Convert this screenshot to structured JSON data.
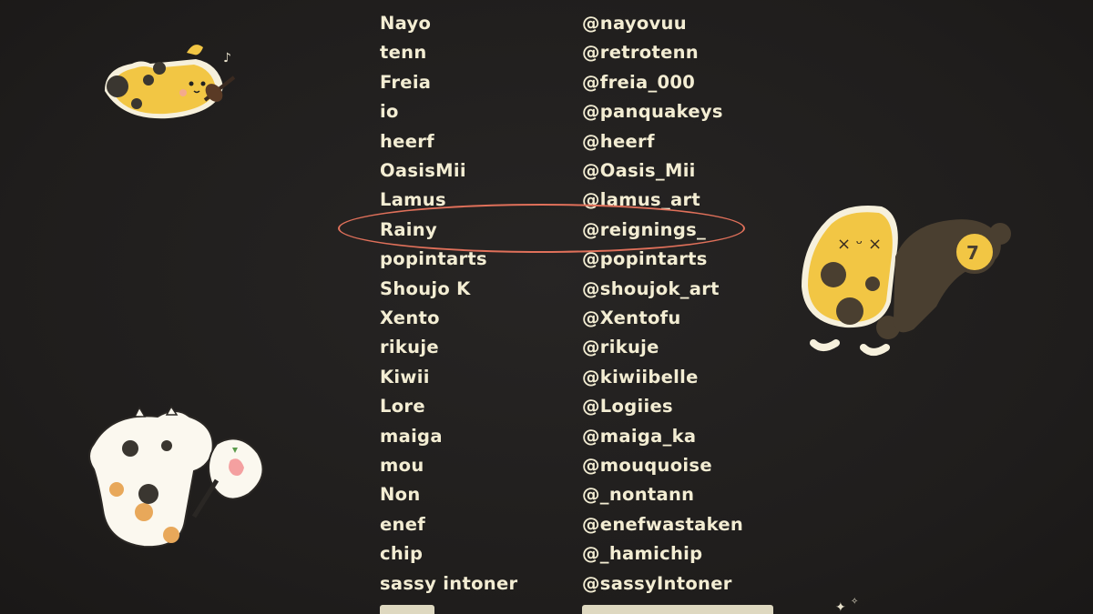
{
  "credits": {
    "rows": [
      {
        "name": "Nayo",
        "handle": "@nayovuu"
      },
      {
        "name": "tenn",
        "handle": "@retrotenn"
      },
      {
        "name": "Freia",
        "handle": "@freia_000"
      },
      {
        "name": "io",
        "handle": "@panquakeys"
      },
      {
        "name": "heerf",
        "handle": "@heerf"
      },
      {
        "name": "OasisMii",
        "handle": "@Oasis_Mii"
      },
      {
        "name": "Lamus",
        "handle": "@lamus_art"
      },
      {
        "name": "Rainy",
        "handle": "@reignings_"
      },
      {
        "name": "popintarts",
        "handle": "@popintarts"
      },
      {
        "name": "Shoujo K",
        "handle": "@shoujok_art"
      },
      {
        "name": "Xento",
        "handle": "@Xentofu"
      },
      {
        "name": "rikuje",
        "handle": "@rikuje"
      },
      {
        "name": "Kiwii",
        "handle": "@kiwiibelle"
      },
      {
        "name": "Lore",
        "handle": "@Logiies"
      },
      {
        "name": "maiga",
        "handle": "@maiga_ka"
      },
      {
        "name": "mou",
        "handle": "@mouquoise"
      },
      {
        "name": "Non",
        "handle": "@_nontann"
      },
      {
        "name": "enef",
        "handle": "@enefwastaken"
      },
      {
        "name": "chip",
        "handle": "@_hamichip"
      },
      {
        "name": "sassy intoner",
        "handle": "@sassyIntoner"
      }
    ],
    "highlighted_name": "Rainy"
  },
  "colors": {
    "background": "#201e1d",
    "text": "#f3edd3",
    "highlight": "#e0705a",
    "creature_yellow": "#f2c644",
    "creature_spot": "#4a3f30"
  },
  "stickers": [
    "yellow-creature-violin-icon",
    "cow-creature-mirror-icon",
    "yellow-spotted-creature-icon",
    "globe-sparkle-icon"
  ]
}
